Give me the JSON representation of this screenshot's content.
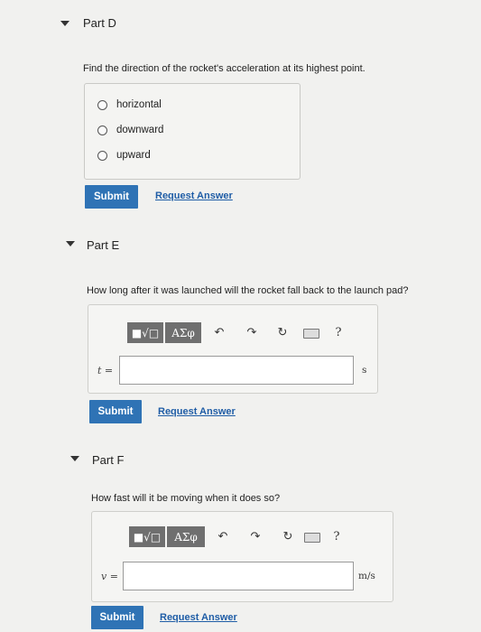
{
  "partD": {
    "title": "Part D",
    "question": "Find the direction of the rocket's acceleration at its highest point.",
    "options": [
      "horizontal",
      "downward",
      "upward"
    ],
    "submit": "Submit",
    "request": "Request Answer"
  },
  "partE": {
    "title": "Part E",
    "question": "How long after it was launched will the rocket fall back to the launch pad?",
    "toolbar": {
      "templates": "■√□",
      "greek": "ΑΣφ",
      "help": "?"
    },
    "variable": "t =",
    "input_value": "",
    "unit": "s",
    "submit": "Submit",
    "request": "Request Answer"
  },
  "partF": {
    "title": "Part F",
    "question": "How fast will it be moving when it does so?",
    "toolbar": {
      "templates": "■√□",
      "greek": "ΑΣφ",
      "help": "?"
    },
    "variable": "v =",
    "input_value": "",
    "unit": "m/s",
    "submit": "Submit",
    "request": "Request Answer"
  }
}
